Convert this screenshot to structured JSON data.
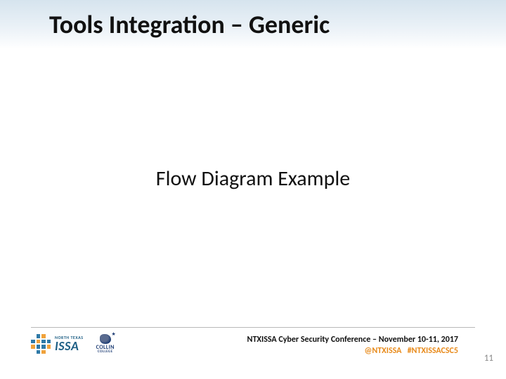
{
  "title": "Tools Integration – Generic",
  "body": "Flow Diagram Example",
  "footer": {
    "conference_line": "NTXISSA Cyber Security Conference – November 10-11, 2017",
    "handle": "@NTXISSA",
    "hashtag": "#NTXISSACSC5"
  },
  "logos": {
    "issa": {
      "top": "NORTH TEXAS",
      "main": "ISSA"
    },
    "collin": {
      "name": "COLLIN",
      "sub": "COLLEGE"
    }
  },
  "page_number": "11"
}
